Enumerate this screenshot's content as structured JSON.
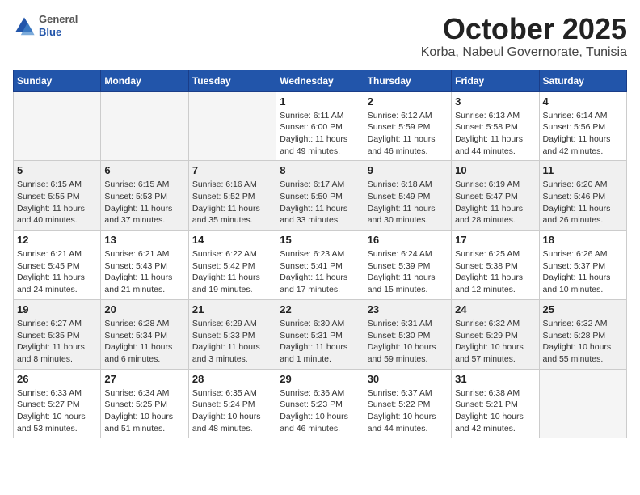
{
  "header": {
    "logo": {
      "general": "General",
      "blue": "Blue"
    },
    "title": "October 2025",
    "location": "Korba, Nabeul Governorate, Tunisia"
  },
  "days_of_week": [
    "Sunday",
    "Monday",
    "Tuesday",
    "Wednesday",
    "Thursday",
    "Friday",
    "Saturday"
  ],
  "weeks": [
    [
      {
        "day": "",
        "info": ""
      },
      {
        "day": "",
        "info": ""
      },
      {
        "day": "",
        "info": ""
      },
      {
        "day": "1",
        "info": "Sunrise: 6:11 AM\nSunset: 6:00 PM\nDaylight: 11 hours\nand 49 minutes."
      },
      {
        "day": "2",
        "info": "Sunrise: 6:12 AM\nSunset: 5:59 PM\nDaylight: 11 hours\nand 46 minutes."
      },
      {
        "day": "3",
        "info": "Sunrise: 6:13 AM\nSunset: 5:58 PM\nDaylight: 11 hours\nand 44 minutes."
      },
      {
        "day": "4",
        "info": "Sunrise: 6:14 AM\nSunset: 5:56 PM\nDaylight: 11 hours\nand 42 minutes."
      }
    ],
    [
      {
        "day": "5",
        "info": "Sunrise: 6:15 AM\nSunset: 5:55 PM\nDaylight: 11 hours\nand 40 minutes."
      },
      {
        "day": "6",
        "info": "Sunrise: 6:15 AM\nSunset: 5:53 PM\nDaylight: 11 hours\nand 37 minutes."
      },
      {
        "day": "7",
        "info": "Sunrise: 6:16 AM\nSunset: 5:52 PM\nDaylight: 11 hours\nand 35 minutes."
      },
      {
        "day": "8",
        "info": "Sunrise: 6:17 AM\nSunset: 5:50 PM\nDaylight: 11 hours\nand 33 minutes."
      },
      {
        "day": "9",
        "info": "Sunrise: 6:18 AM\nSunset: 5:49 PM\nDaylight: 11 hours\nand 30 minutes."
      },
      {
        "day": "10",
        "info": "Sunrise: 6:19 AM\nSunset: 5:47 PM\nDaylight: 11 hours\nand 28 minutes."
      },
      {
        "day": "11",
        "info": "Sunrise: 6:20 AM\nSunset: 5:46 PM\nDaylight: 11 hours\nand 26 minutes."
      }
    ],
    [
      {
        "day": "12",
        "info": "Sunrise: 6:21 AM\nSunset: 5:45 PM\nDaylight: 11 hours\nand 24 minutes."
      },
      {
        "day": "13",
        "info": "Sunrise: 6:21 AM\nSunset: 5:43 PM\nDaylight: 11 hours\nand 21 minutes."
      },
      {
        "day": "14",
        "info": "Sunrise: 6:22 AM\nSunset: 5:42 PM\nDaylight: 11 hours\nand 19 minutes."
      },
      {
        "day": "15",
        "info": "Sunrise: 6:23 AM\nSunset: 5:41 PM\nDaylight: 11 hours\nand 17 minutes."
      },
      {
        "day": "16",
        "info": "Sunrise: 6:24 AM\nSunset: 5:39 PM\nDaylight: 11 hours\nand 15 minutes."
      },
      {
        "day": "17",
        "info": "Sunrise: 6:25 AM\nSunset: 5:38 PM\nDaylight: 11 hours\nand 12 minutes."
      },
      {
        "day": "18",
        "info": "Sunrise: 6:26 AM\nSunset: 5:37 PM\nDaylight: 11 hours\nand 10 minutes."
      }
    ],
    [
      {
        "day": "19",
        "info": "Sunrise: 6:27 AM\nSunset: 5:35 PM\nDaylight: 11 hours\nand 8 minutes."
      },
      {
        "day": "20",
        "info": "Sunrise: 6:28 AM\nSunset: 5:34 PM\nDaylight: 11 hours\nand 6 minutes."
      },
      {
        "day": "21",
        "info": "Sunrise: 6:29 AM\nSunset: 5:33 PM\nDaylight: 11 hours\nand 3 minutes."
      },
      {
        "day": "22",
        "info": "Sunrise: 6:30 AM\nSunset: 5:31 PM\nDaylight: 11 hours\nand 1 minute."
      },
      {
        "day": "23",
        "info": "Sunrise: 6:31 AM\nSunset: 5:30 PM\nDaylight: 10 hours\nand 59 minutes."
      },
      {
        "day": "24",
        "info": "Sunrise: 6:32 AM\nSunset: 5:29 PM\nDaylight: 10 hours\nand 57 minutes."
      },
      {
        "day": "25",
        "info": "Sunrise: 6:32 AM\nSunset: 5:28 PM\nDaylight: 10 hours\nand 55 minutes."
      }
    ],
    [
      {
        "day": "26",
        "info": "Sunrise: 6:33 AM\nSunset: 5:27 PM\nDaylight: 10 hours\nand 53 minutes."
      },
      {
        "day": "27",
        "info": "Sunrise: 6:34 AM\nSunset: 5:25 PM\nDaylight: 10 hours\nand 51 minutes."
      },
      {
        "day": "28",
        "info": "Sunrise: 6:35 AM\nSunset: 5:24 PM\nDaylight: 10 hours\nand 48 minutes."
      },
      {
        "day": "29",
        "info": "Sunrise: 6:36 AM\nSunset: 5:23 PM\nDaylight: 10 hours\nand 46 minutes."
      },
      {
        "day": "30",
        "info": "Sunrise: 6:37 AM\nSunset: 5:22 PM\nDaylight: 10 hours\nand 44 minutes."
      },
      {
        "day": "31",
        "info": "Sunrise: 6:38 AM\nSunset: 5:21 PM\nDaylight: 10 hours\nand 42 minutes."
      },
      {
        "day": "",
        "info": ""
      }
    ]
  ]
}
